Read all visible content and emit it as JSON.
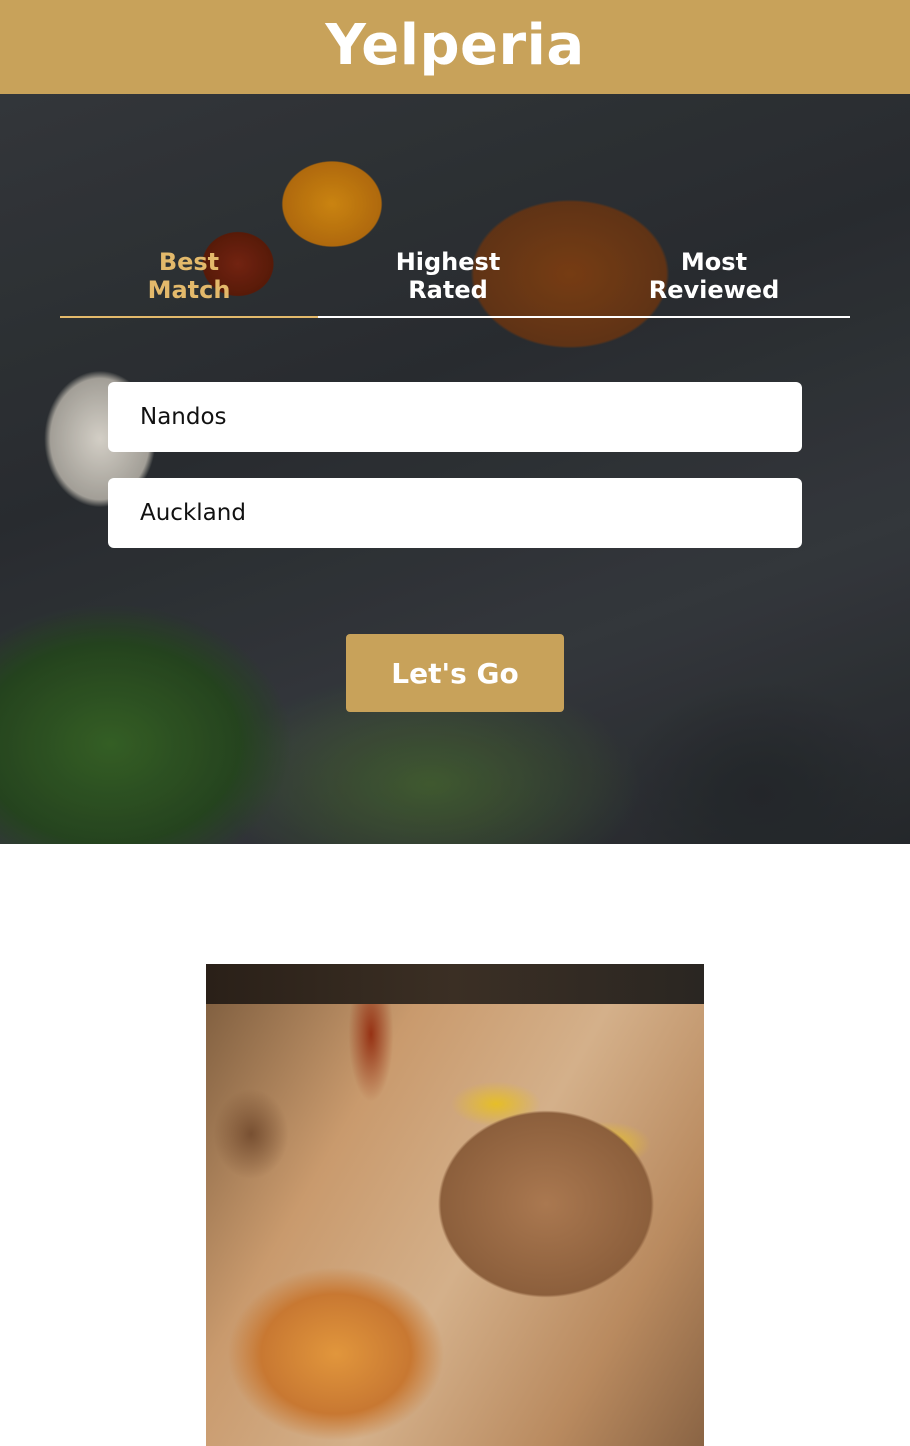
{
  "app": {
    "title": "Yelperia"
  },
  "sort_tabs": [
    {
      "line1": "Best",
      "line2": "Match",
      "active": true
    },
    {
      "line1": "Highest",
      "line2": "Rated",
      "active": false
    },
    {
      "line1": "Most",
      "line2": "Reviewed",
      "active": false
    }
  ],
  "search": {
    "term_value": "Nandos",
    "location_value": "Auckland",
    "submit_label": "Let's Go"
  },
  "colors": {
    "accent": "#c8a25a",
    "active_tab": "#e3b96b"
  }
}
